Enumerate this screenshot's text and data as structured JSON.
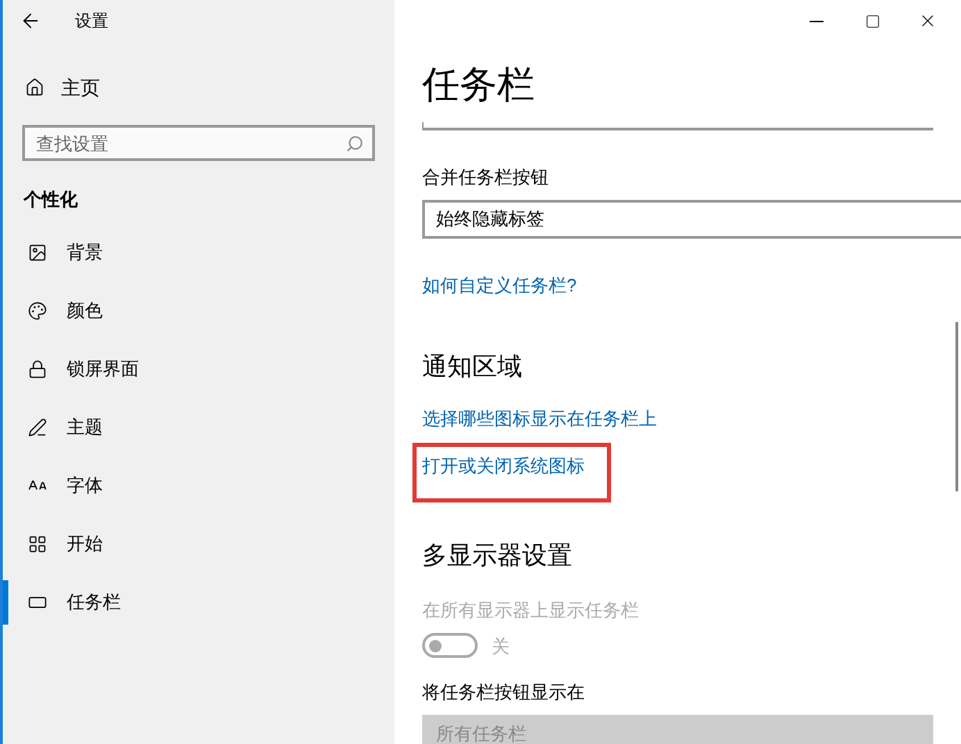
{
  "window": {
    "title": "设置"
  },
  "sidebar": {
    "home": "主页",
    "search": {
      "placeholder": "查找设置"
    },
    "section": "个性化",
    "items": [
      {
        "label": "背景",
        "selected": false
      },
      {
        "label": "颜色",
        "selected": false
      },
      {
        "label": "锁屏界面",
        "selected": false
      },
      {
        "label": "主题",
        "selected": false
      },
      {
        "label": "字体",
        "selected": false
      },
      {
        "label": "开始",
        "selected": false
      },
      {
        "label": "任务栏",
        "selected": true
      }
    ]
  },
  "content": {
    "title": "任务栏",
    "combine_buttons": {
      "label": "合并任务栏按钮",
      "value": "始终隐藏标签"
    },
    "help_link": "如何自定义任务栏?",
    "notification_area": {
      "heading": "通知区域",
      "links": [
        {
          "label": "选择哪些图标显示在任务栏上",
          "highlighted": false
        },
        {
          "label": "打开或关闭系统图标",
          "highlighted": true
        }
      ]
    },
    "multi_display": {
      "heading": "多显示器设置",
      "toggle": {
        "label": "在所有显示器上显示任务栏",
        "on": false,
        "state_text": "关",
        "disabled": true
      },
      "show_buttons": {
        "label": "将任务栏按钮显示在",
        "value": "所有任务栏",
        "disabled": true
      }
    }
  }
}
